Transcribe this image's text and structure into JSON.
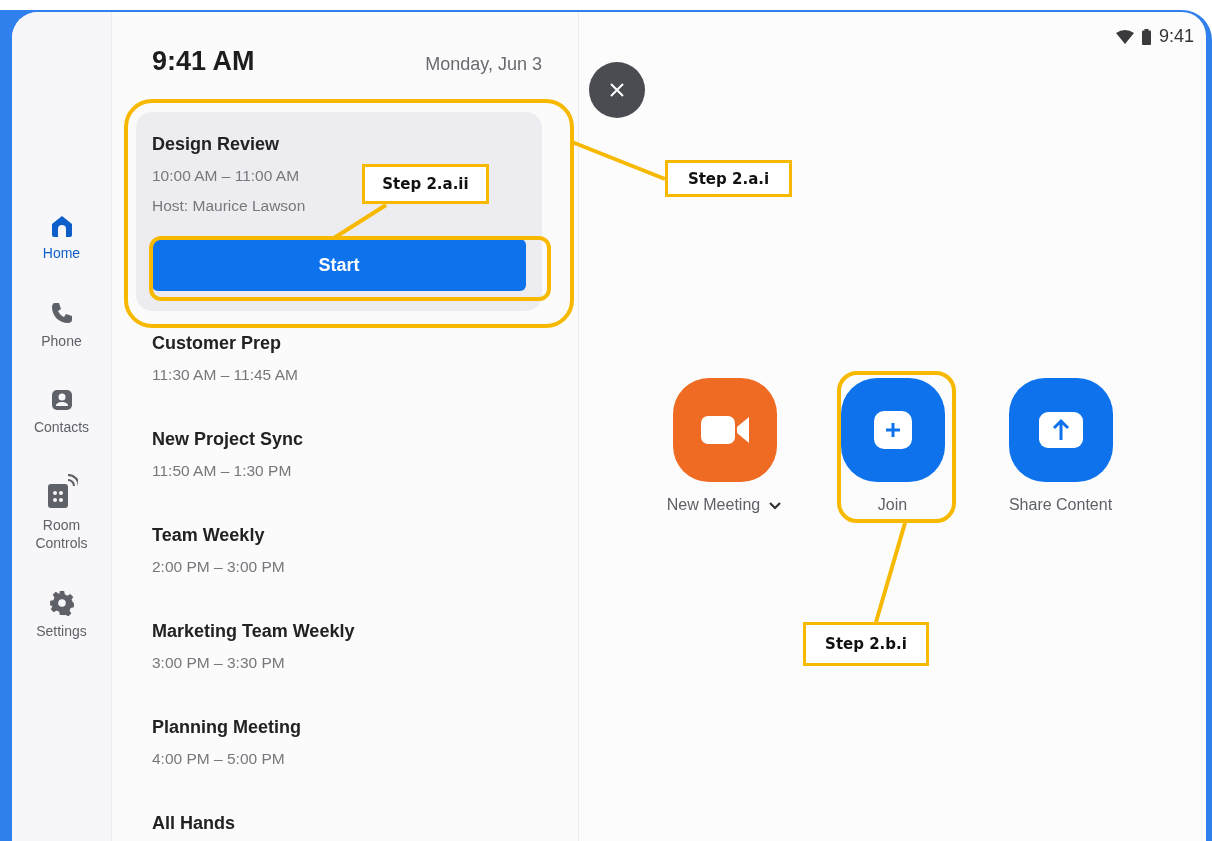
{
  "status_bar": {
    "time": "9:41"
  },
  "sidebar": {
    "items": [
      {
        "label": "Home",
        "kind": "home",
        "selected": true
      },
      {
        "label": "Phone",
        "kind": "phone",
        "selected": false
      },
      {
        "label": "Contacts",
        "kind": "contacts",
        "selected": false
      },
      {
        "label": "Room Controls",
        "kind": "room",
        "selected": false
      },
      {
        "label": "Settings",
        "kind": "settings",
        "selected": false
      }
    ]
  },
  "schedule": {
    "time": "9:41 AM",
    "date": "Monday, Jun 3",
    "featured": {
      "title": "Design Review",
      "time": "10:00 AM – 11:00 AM",
      "host": "Host: Maurice Lawson",
      "button": "Start"
    },
    "meetings": [
      {
        "title": "Customer Prep",
        "time": "11:30 AM – 11:45 AM"
      },
      {
        "title": "New Project Sync",
        "time": "11:50 AM – 1:30 PM"
      },
      {
        "title": "Team Weekly",
        "time": "2:00 PM – 3:00 PM"
      },
      {
        "title": "Marketing Team Weekly",
        "time": "3:00 PM – 3:30 PM"
      },
      {
        "title": "Planning Meeting",
        "time": "4:00 PM – 5:00 PM"
      },
      {
        "title": "All Hands"
      }
    ]
  },
  "actions": [
    {
      "label": "New Meeting",
      "kind": "video",
      "dropdown": true
    },
    {
      "label": "Join",
      "kind": "join",
      "dropdown": false
    },
    {
      "label": "Share Content",
      "kind": "share",
      "dropdown": false
    }
  ],
  "annotations": [
    {
      "label": "Step 2.a.i"
    },
    {
      "label": "Step 2.a.ii"
    },
    {
      "label": "Step 2.b.i"
    }
  ]
}
